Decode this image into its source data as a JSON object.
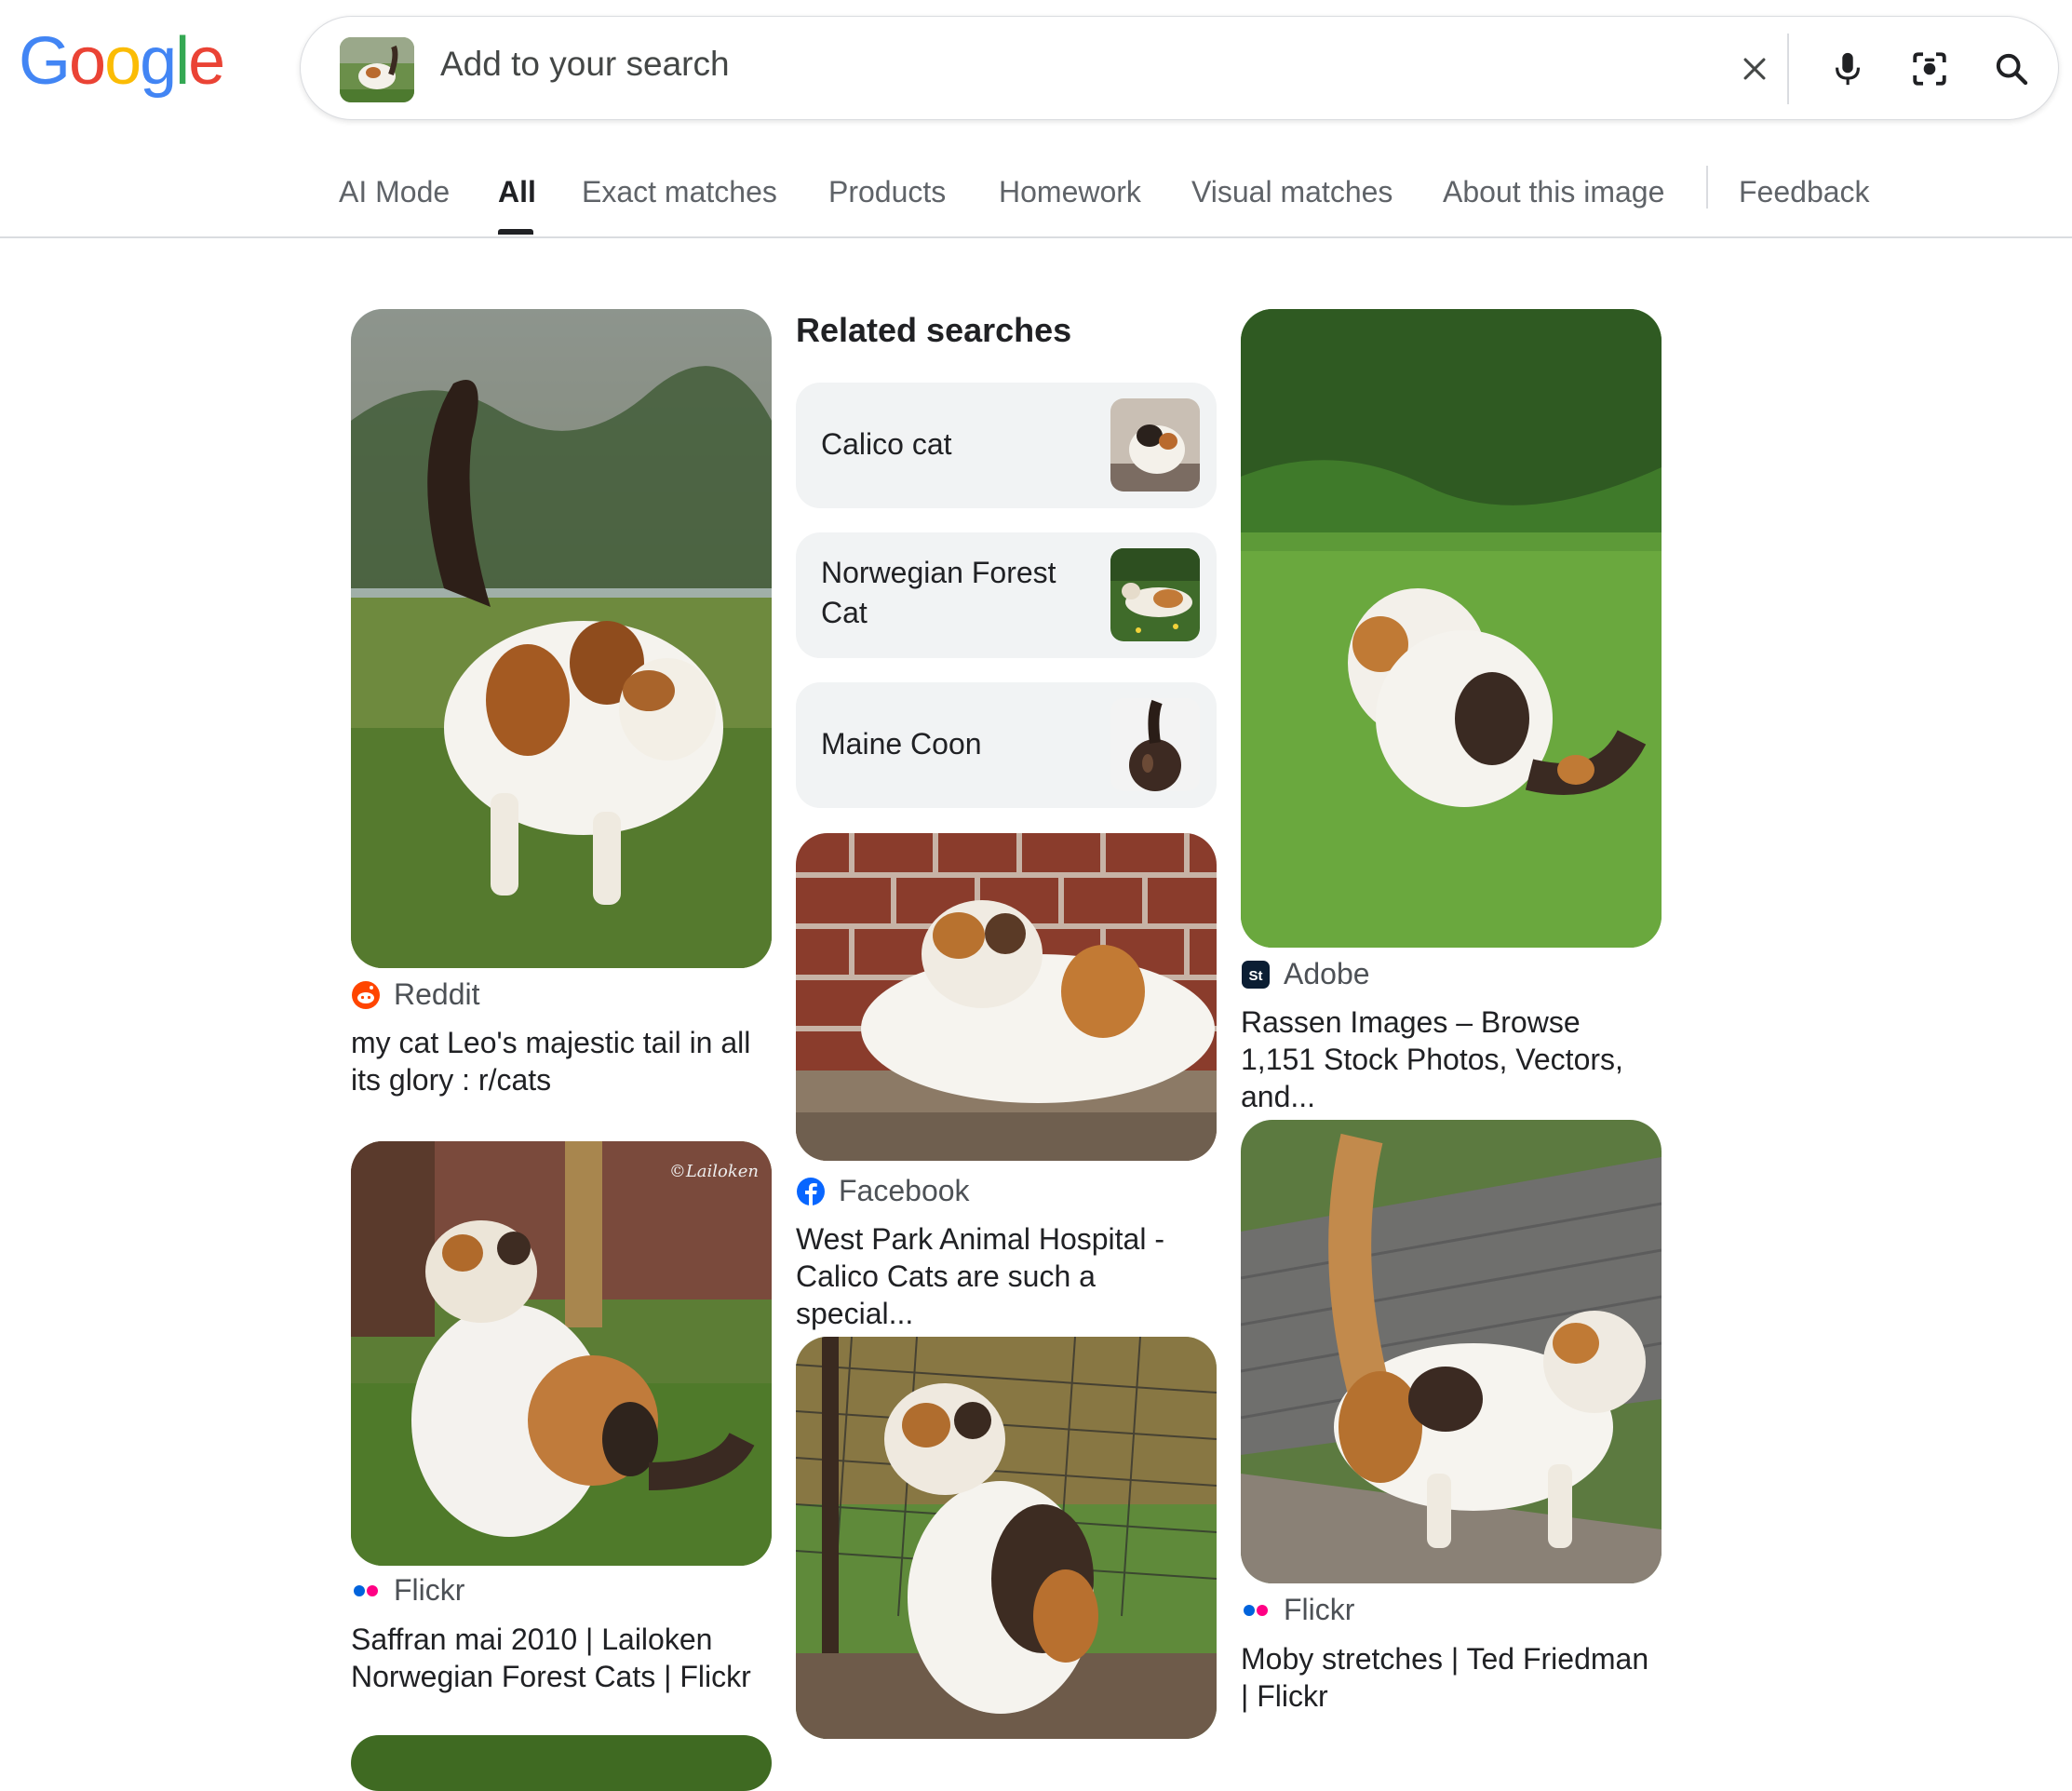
{
  "logo": {
    "letters": [
      {
        "ch": "G",
        "color": "#4285F4"
      },
      {
        "ch": "o",
        "color": "#EA4335"
      },
      {
        "ch": "o",
        "color": "#FBBC05"
      },
      {
        "ch": "g",
        "color": "#4285F4"
      },
      {
        "ch": "l",
        "color": "#34A853"
      },
      {
        "ch": "e",
        "color": "#EA4335"
      }
    ]
  },
  "search": {
    "placeholder": "Add to your search",
    "icons": [
      "close-icon",
      "microphone-icon",
      "camera-lens-icon",
      "search-icon"
    ]
  },
  "tabs": [
    {
      "label": "AI Mode",
      "active": false
    },
    {
      "label": "All",
      "active": true
    },
    {
      "label": "Exact matches",
      "active": false
    },
    {
      "label": "Products",
      "active": false
    },
    {
      "label": "Homework",
      "active": false
    },
    {
      "label": "Visual matches",
      "active": false
    },
    {
      "label": "About this image",
      "active": false
    },
    {
      "label": "Feedback",
      "active": false
    }
  ],
  "related": {
    "title": "Related searches",
    "items": [
      {
        "label": "Calico cat"
      },
      {
        "label": "Norwegian Forest Cat"
      },
      {
        "label": "Maine Coon"
      }
    ]
  },
  "results": [
    {
      "source": "Reddit",
      "source_icon": "reddit-icon",
      "caption": "my cat Leo's majestic tail in all its glory : r/cats"
    },
    {
      "source": "Flickr",
      "source_icon": "flickr-icon",
      "caption": "Saffran mai 2010 | Lailoken Norwegian Forest Cats | Flickr",
      "watermark": "©Lailoken"
    },
    {
      "source": "Facebook",
      "source_icon": "facebook-icon",
      "caption": "West Park Animal Hospital - Calico Cats are such a special..."
    },
    {
      "source": "Adobe",
      "source_icon": "adobe-stock-icon",
      "caption": "Rassen Images – Browse 1,151 Stock Photos, Vectors, and..."
    },
    {
      "source": "Flickr",
      "source_icon": "flickr-icon",
      "caption": "Moby stretches | Ted Friedman | Flickr"
    }
  ],
  "colors": {
    "tab_active": "#202124",
    "tab_inactive": "#5f6368",
    "chip_bg": "#f1f3f4",
    "reddit": "#FF4500",
    "facebook": "#0866FF",
    "flickr_blue": "#0063DC",
    "flickr_pink": "#FF0084"
  }
}
